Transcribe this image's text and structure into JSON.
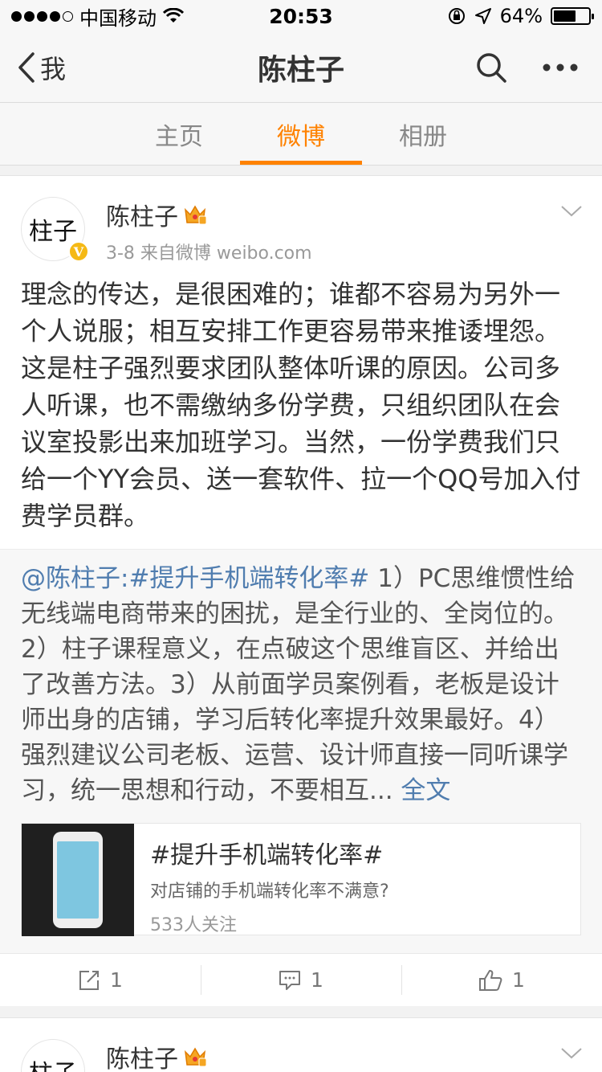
{
  "status_bar": {
    "carrier": "中国移动",
    "time": "20:53",
    "battery": "64%",
    "battery_level": 0.64
  },
  "nav": {
    "back_label": "我",
    "title": "陈柱子"
  },
  "tabs": [
    {
      "label": "主页",
      "active": false
    },
    {
      "label": "微博",
      "active": true
    },
    {
      "label": "相册",
      "active": false
    }
  ],
  "post": {
    "avatar_text": "柱子",
    "username": "陈柱子",
    "meta": "3-8  来自微博 weibo.com",
    "text": "理念的传达，是很困难的；谁都不容易为另外一个人说服；相互安排工作更容易带来推诿埋怨。这是柱子强烈要求团队整体听课的原因。公司多人听课，也不需缴纳多份学费，只组织团队在会议室投影出来加班学习。当然，一份学费我们只给一个YY会员、送一套软件、拉一个QQ号加入付费学员群。",
    "repost": {
      "mention": "@陈柱子:",
      "topic": "#提升手机端转化率#",
      "body": " 1）PC思维惯性给无线端电商带来的困扰，是全行业的、全岗位的。2）柱子课程意义，在点破这个思维盲区、并给出了改善方法。3）从前面学员案例看，老板是设计师出身的店铺，学习后转化率提升效果最好。4）强烈建议公司老板、运营、设计师直接一同听课学习，统一思想和行动，不要相互...",
      "more": "全文"
    },
    "topic_card": {
      "title": "#提升手机端转化率#",
      "desc": "对店铺的手机端转化率不满意?",
      "followers": "533人关注"
    },
    "actions": {
      "repost_count": "1",
      "comment_count": "1",
      "like_count": "1"
    }
  },
  "next_post": {
    "avatar_text": "柱子",
    "username": "陈柱子"
  }
}
